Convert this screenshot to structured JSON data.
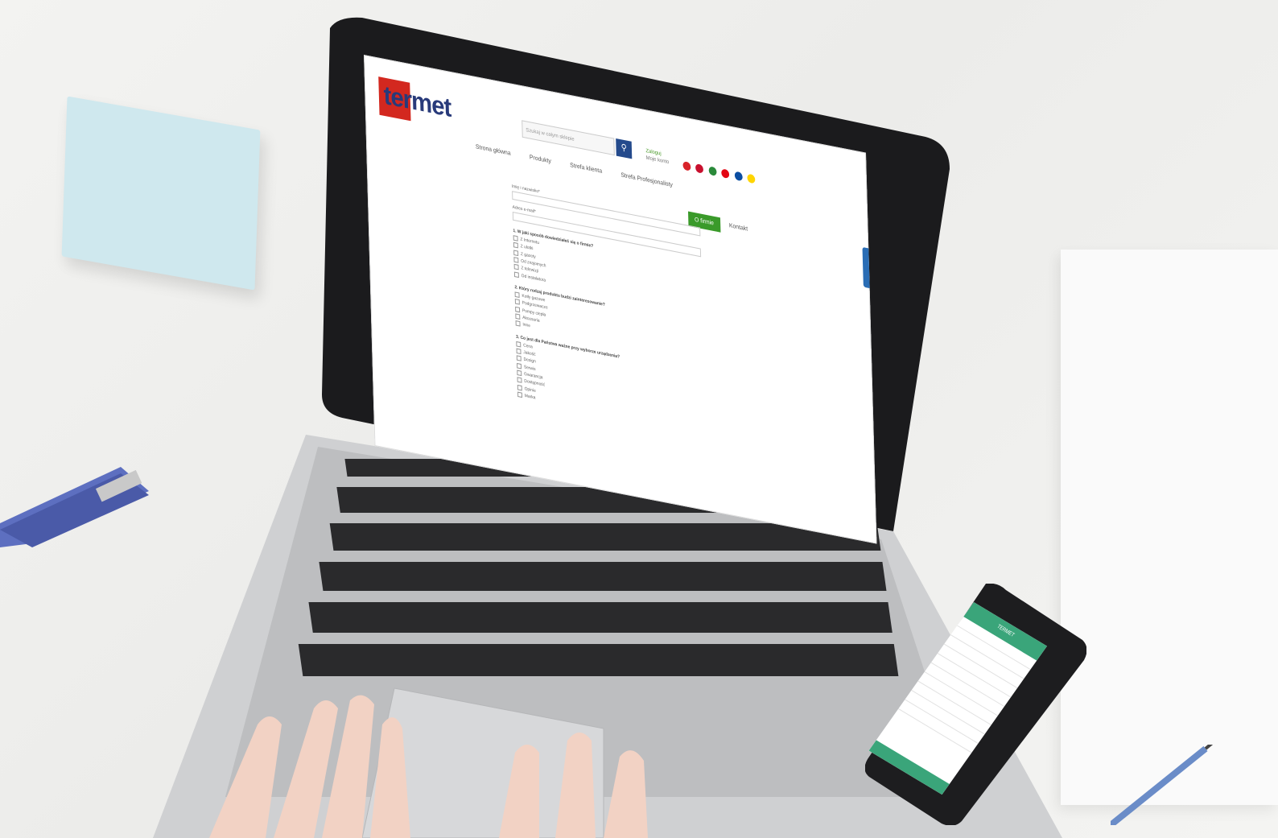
{
  "website": {
    "logo_text": "termet",
    "search_placeholder": "Szukaj w całym sklepie",
    "search_icon": "magnifier-icon",
    "login": {
      "line1": "Zaloguj",
      "line2": "Moje konto"
    },
    "nav_items": [
      "Strona główna",
      "Produkty",
      "Strefa klienta",
      "Strefa Profesjonalisty"
    ],
    "nav_active": "O firmie",
    "nav_after": "Kontakt",
    "flags": [
      "#d8232a",
      "#c8102e",
      "#c8102e",
      "#e30613",
      "#0b4ea2",
      "#ffd500"
    ],
    "form": {
      "fields": [
        "Imię i nazwisko*",
        "Adres e-mail*"
      ],
      "questions": [
        {
          "title": "1. W jaki sposób dowiedziałeś się o firmie?",
          "options": [
            "Z Internetu",
            "Z ulotki",
            "Z gazety",
            "Od znajomych",
            "Z telewizji",
            "Od instalatora"
          ]
        },
        {
          "title": "2. Który rodzaj produktu budzi zainteresowanie?",
          "options": [
            "Kotły gazowe",
            "Podgrzewacze",
            "Pompy ciepła",
            "Akcesoria",
            "Inne"
          ]
        },
        {
          "title": "3. Co jest dla Państwa ważne przy wyborze urządzenia?",
          "options": [
            "Cena",
            "Jakość",
            "Design",
            "Serwis",
            "Gwarancja",
            "Dostępność",
            "Opinie",
            "Marka"
          ]
        }
      ]
    }
  },
  "phone": {
    "header": "TERMET"
  },
  "colors": {
    "brand_red": "#d3281f",
    "brand_blue": "#283a7a",
    "accent_green": "#3a9a2a",
    "phone_green": "#3aa57a"
  }
}
